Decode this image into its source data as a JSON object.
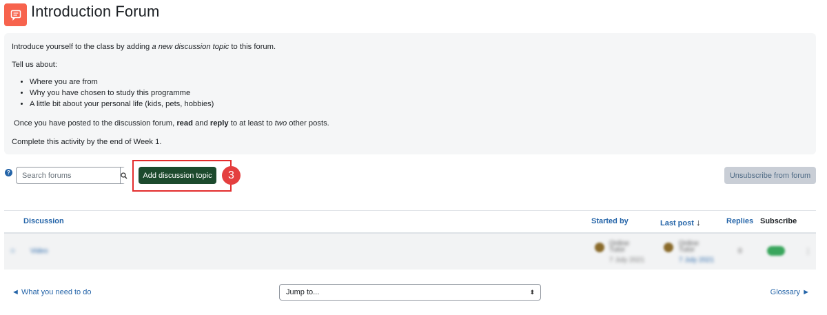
{
  "page": {
    "title": "Introduction Forum",
    "icon": "forum-icon",
    "accent_color": "#f7634d"
  },
  "intro": {
    "line1_pre": "Introduce yourself to the class by adding ",
    "line1_em": "a new discussion topic",
    "line1_post": " to this forum.",
    "tell_us": "Tell us about:",
    "bullets": [
      "Where you are from",
      "Why you have chosen to study this programme",
      "A little bit about your personal life (kids, pets, hobbies)"
    ],
    "posted_pre": "Once you have posted to the discussion forum, ",
    "posted_read": "read",
    "posted_and": " and ",
    "posted_reply": "reply",
    "posted_mid": " to at least to ",
    "posted_two": "two",
    "posted_post": " other posts.",
    "complete": "Complete this activity by the end of Week 1."
  },
  "toolbar": {
    "help_icon": "?",
    "search_placeholder": "Search forums",
    "add_topic_label": "Add discussion topic",
    "step_number": "3",
    "unsubscribe_label": "Unsubscribe from forum"
  },
  "table": {
    "columns": {
      "discussion": "Discussion",
      "started_by": "Started by",
      "last_post": "Last post",
      "last_post_sort": "↓",
      "replies": "Replies",
      "subscribe": "Subscribe"
    },
    "row": {
      "title": "Video",
      "started_by_name": "Online Tutor",
      "started_by_date": "7 July 2021",
      "last_post_name": "Online Tutor",
      "last_post_date": "7 July 2021",
      "replies": "0",
      "subscribed": true
    }
  },
  "footer": {
    "prev_link": "◄ What you need to do",
    "jump_placeholder": "Jump to...",
    "jump_arrow": "⬍",
    "next_link": "Glossary ►"
  }
}
